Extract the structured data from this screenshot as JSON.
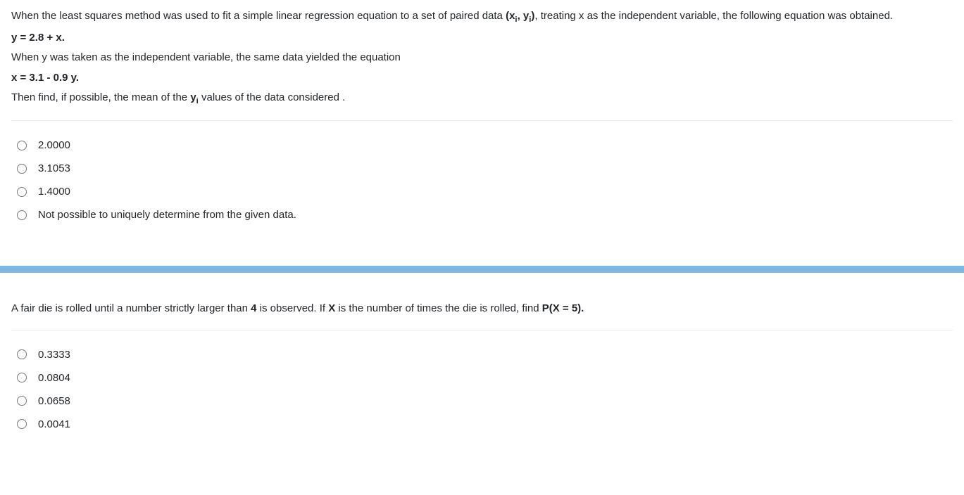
{
  "q1": {
    "p1_a": "When the least squares method was used to fit a simple linear regression equation to a set of paired data ",
    "p1_b": "(x",
    "p1_sub1": "i",
    "p1_c": ", y",
    "p1_sub2": "i",
    "p1_d": ")",
    "p1_e": ", treating x as the independent variable, the following equation was obtained.",
    "p2": "y = 2.8 + x.",
    "p3": "When y was taken as the independent variable, the same data yielded the equation",
    "p4": "x = 3.1 - 0.9 y.",
    "p5_a": "Then find, if possible, the mean of the ",
    "p5_b": "y",
    "p5_sub": "i",
    "p5_c": " values of the data considered .",
    "options": [
      "2.0000",
      "3.1053",
      "1.4000",
      "Not possible to uniquely determine from the given data."
    ]
  },
  "q2": {
    "p1_a": "A fair die is rolled until a number strictly larger than ",
    "p1_b": "4",
    "p1_c": " is observed. If ",
    "p1_d": "X",
    "p1_e": " is the number of times the die is rolled, find ",
    "p1_f": "P(X = 5).",
    "options": [
      "0.3333",
      "0.0804",
      "0.0658",
      "0.0041"
    ]
  }
}
